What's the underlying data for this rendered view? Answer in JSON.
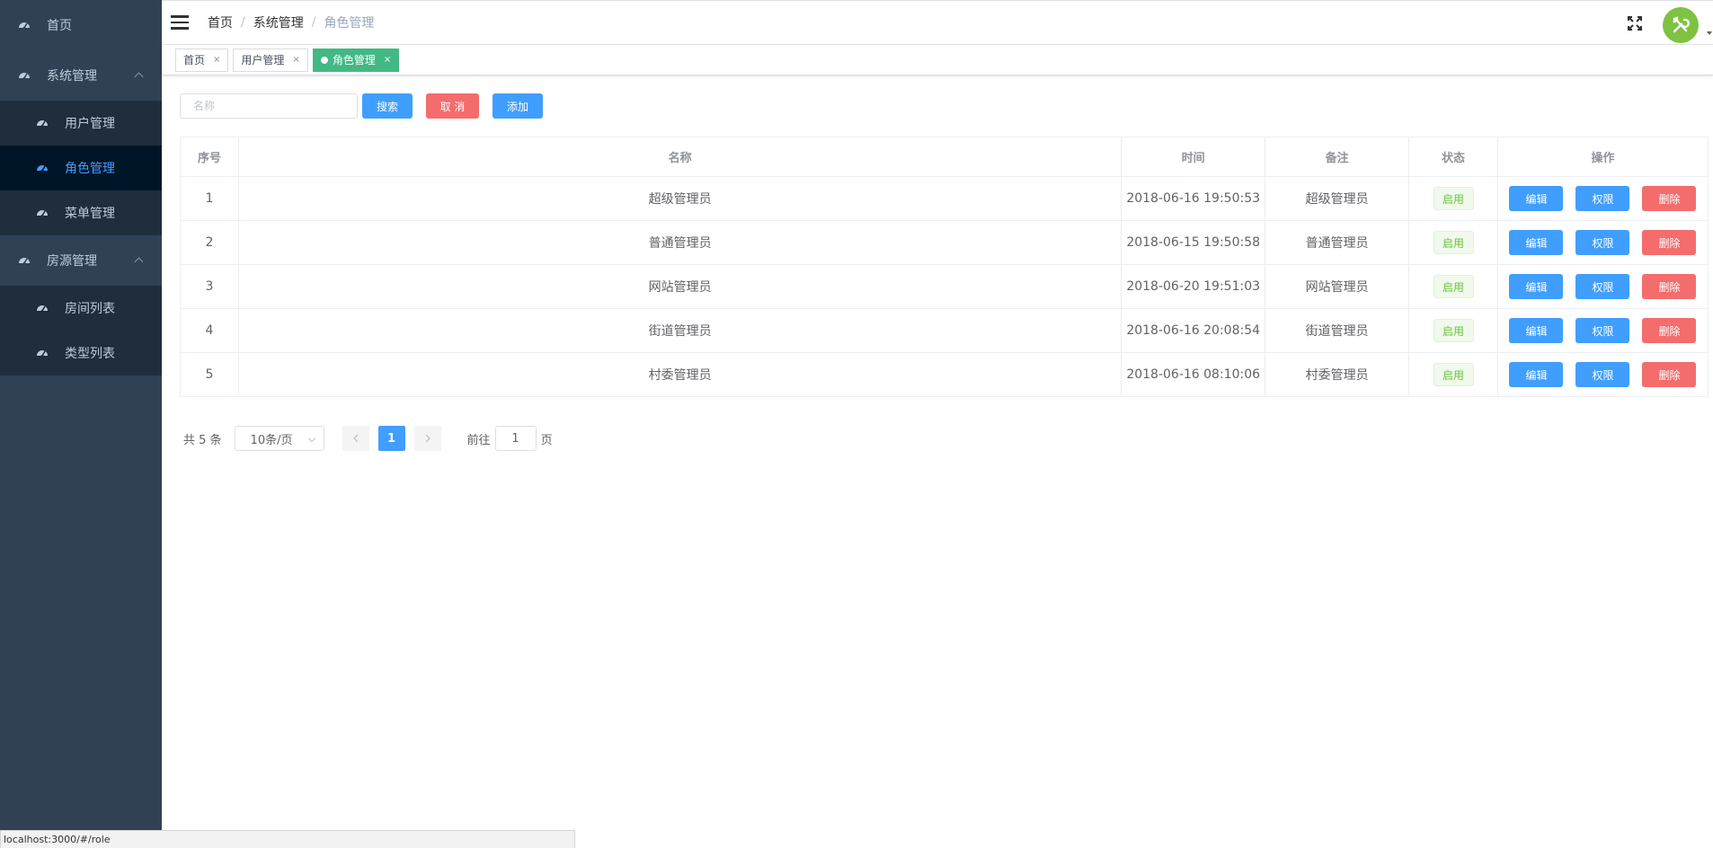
{
  "sidebar": {
    "items": [
      {
        "label": "首页"
      },
      {
        "label": "系统管理",
        "children": [
          {
            "label": "用户管理"
          },
          {
            "label": "角色管理",
            "active": true
          },
          {
            "label": "菜单管理"
          }
        ]
      },
      {
        "label": "房源管理",
        "children": [
          {
            "label": "房间列表"
          },
          {
            "label": "类型列表"
          }
        ]
      }
    ]
  },
  "header": {
    "breadcrumb": [
      "首页",
      "系统管理",
      "角色管理"
    ],
    "separator": "/"
  },
  "tags": [
    {
      "label": "首页"
    },
    {
      "label": "用户管理"
    },
    {
      "label": "角色管理",
      "active": true
    }
  ],
  "filter": {
    "name_placeholder": "名称",
    "search_label": "搜索",
    "cancel_label": "取 消",
    "add_label": "添加"
  },
  "table": {
    "columns": [
      "序号",
      "名称",
      "时间",
      "备注",
      "状态",
      "操作"
    ],
    "rows": [
      {
        "index": "1",
        "name": "超级管理员",
        "time": "2018-06-16 19:50:53",
        "remark": "超级管理员",
        "status": "启用"
      },
      {
        "index": "2",
        "name": "普通管理员",
        "time": "2018-06-15 19:50:58",
        "remark": "普通管理员",
        "status": "启用"
      },
      {
        "index": "3",
        "name": "网站管理员",
        "time": "2018-06-20 19:51:03",
        "remark": "网站管理员",
        "status": "启用"
      },
      {
        "index": "4",
        "name": "街道管理员",
        "time": "2018-06-16 20:08:54",
        "remark": "街道管理员",
        "status": "启用"
      },
      {
        "index": "5",
        "name": "村委管理员",
        "time": "2018-06-16 08:10:06",
        "remark": "村委管理员",
        "status": "启用"
      }
    ],
    "actions": {
      "edit": "编辑",
      "permission": "权限",
      "delete": "删除"
    }
  },
  "pagination": {
    "total": "共 5 条",
    "page_size": "10条/页",
    "current_page": "1",
    "goto_label": "前往",
    "goto_value": "1",
    "page_suffix": "页"
  },
  "statusbar": {
    "url": "localhost:3000/#/role"
  },
  "colors": {
    "sidebar_bg": "#304156",
    "submenu_bg": "#1f2d3d",
    "active_menu_text": "#409eff",
    "active_tag": "#42b983",
    "primary": "#409eff",
    "danger": "#f56c6c",
    "success": "#67c23a",
    "avatar_bg": "#7ec242"
  },
  "icons": {
    "menu": "dashboard-icon",
    "header_toggle": "hamburger-icon",
    "fullscreen": "fullscreen-icon",
    "avatar": "tools-icon"
  }
}
